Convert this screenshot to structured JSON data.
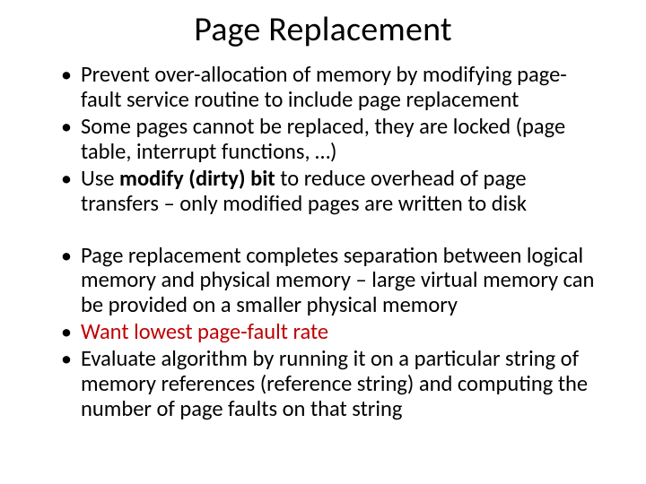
{
  "title": "Page Replacement",
  "bullets": {
    "b0": {
      "pre": "Prevent over-allocation of memory by modifying page-fault service routine to include page replacement"
    },
    "b1": {
      "pre": "Some pages cannot be replaced, they are locked (page table, interrupt functions, …)"
    },
    "b2": {
      "pre": "Use ",
      "bold": "modify (dirty) bit",
      "post": " to reduce overhead of page transfers – only modified pages are written to disk"
    },
    "b3": {
      "pre": "Page replacement completes separation between logical memory and physical memory – large virtual memory can be provided on a smaller physical memory"
    },
    "b4": {
      "red": "Want lowest page-fault rate"
    },
    "b5": {
      "pre": "Evaluate algorithm by running it on a particular string of memory references (reference string) and computing the number of page faults on that string"
    }
  }
}
